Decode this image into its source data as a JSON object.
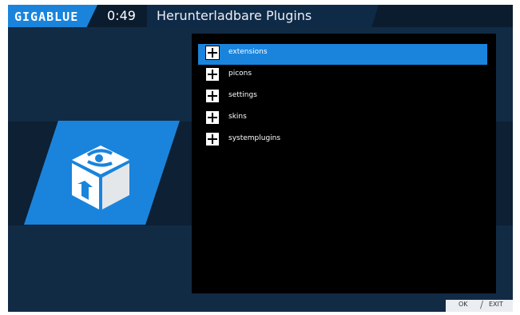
{
  "header": {
    "logo": "GIGABLUE",
    "clock": "0:49",
    "title": "Herunterladbare Plugins"
  },
  "plugin_list": {
    "items": [
      {
        "label": "extensions",
        "selected": true,
        "icon": "plus-icon"
      },
      {
        "label": "picons",
        "selected": false,
        "icon": "plus-icon"
      },
      {
        "label": "settings",
        "selected": false,
        "icon": "plus-icon"
      },
      {
        "label": "skins",
        "selected": false,
        "icon": "plus-icon"
      },
      {
        "label": "systemplugins",
        "selected": false,
        "icon": "plus-icon"
      }
    ]
  },
  "footer": {
    "ok_label": "OK",
    "exit_label": "EXIT"
  },
  "colors": {
    "accent": "#1a84dc",
    "background": "#122b45",
    "list_background": "#000000"
  }
}
